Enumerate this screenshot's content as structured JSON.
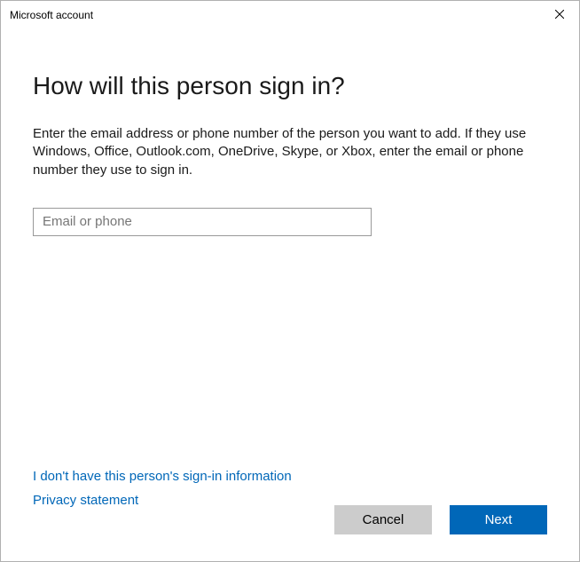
{
  "titlebar": {
    "title": "Microsoft account"
  },
  "main": {
    "heading": "How will this person sign in?",
    "description": "Enter the email address or phone number of the person you want to add. If they use Windows, Office, Outlook.com, OneDrive, Skype, or Xbox, enter the email or phone number they use to sign in.",
    "email_placeholder": "Email or phone",
    "email_value": ""
  },
  "links": {
    "no_info": "I don't have this person's sign-in information",
    "privacy": "Privacy statement"
  },
  "buttons": {
    "cancel": "Cancel",
    "next": "Next"
  }
}
